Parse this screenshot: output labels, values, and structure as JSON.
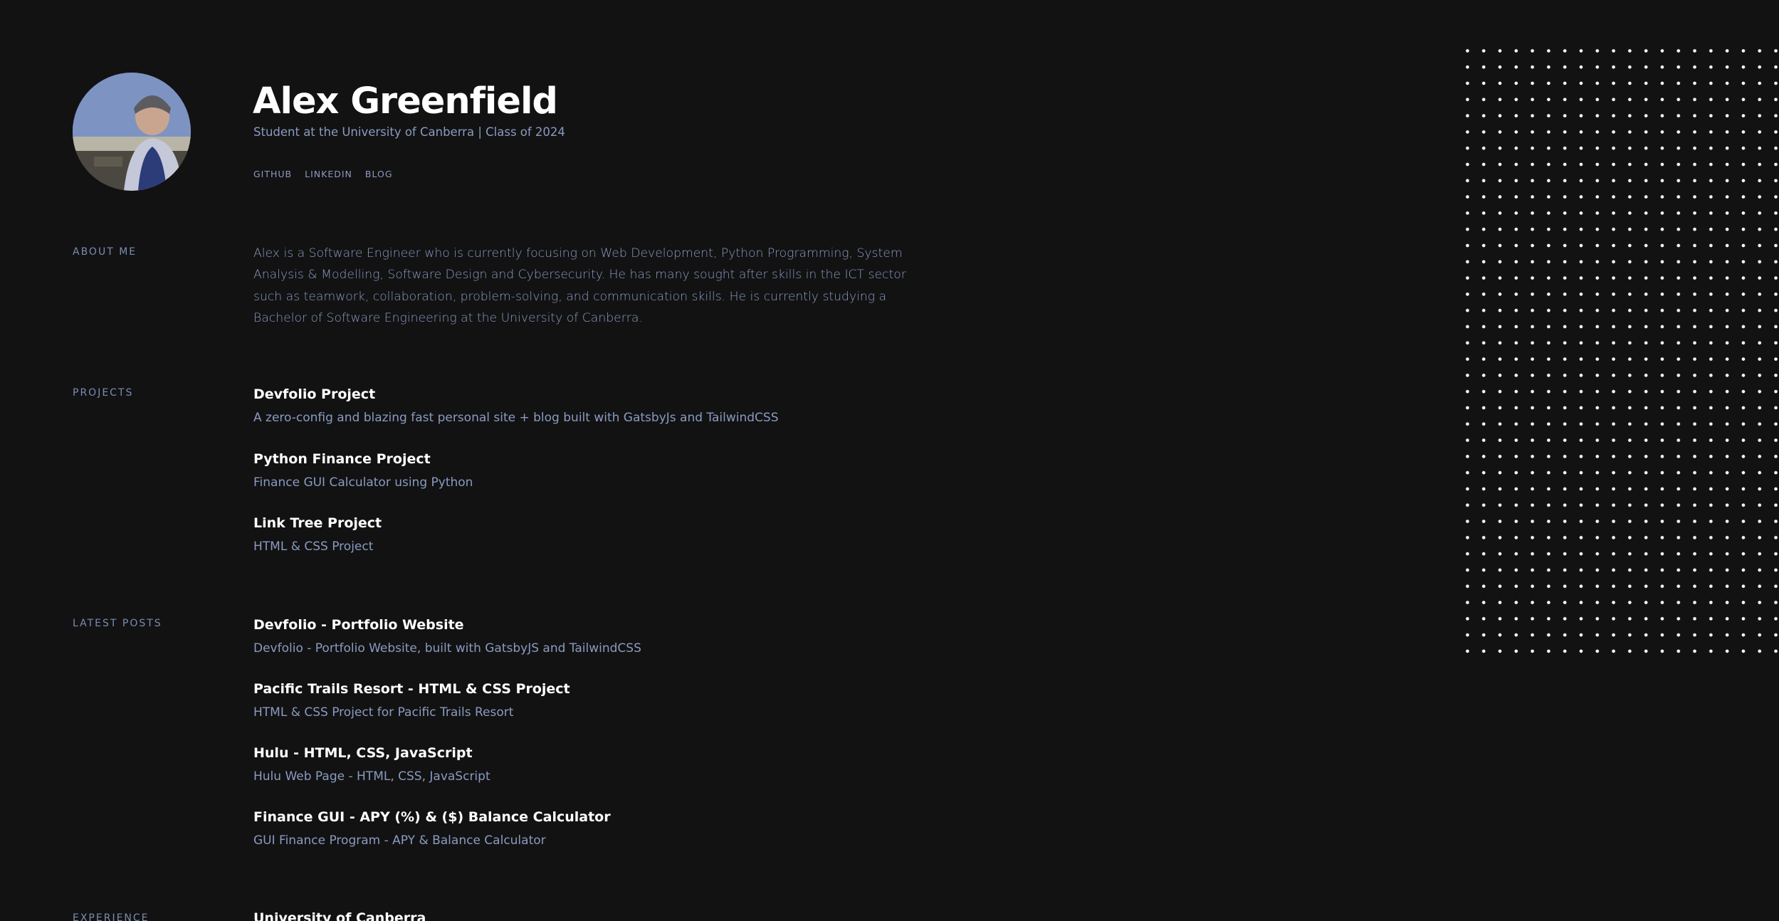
{
  "profile": {
    "name": "Alex Greenfield",
    "subtitle": "Student at the University of Canberra | Class of 2024",
    "links": [
      "GITHUB",
      "LINKEDIN",
      "BLOG"
    ]
  },
  "about": {
    "label": "ABOUT ME",
    "text": "Alex is a Software Engineer who is currently focusing on Web Development, Python Programming, System Analysis & Modelling, Software Design and Cybersecurity. He has many sought after skills in the ICT sector such as teamwork, collaboration, problem-solving, and communication skills. He is currently studying a Bachelor of Software Engineering at the University of Canberra."
  },
  "projects": {
    "label": "PROJECTS",
    "items": [
      {
        "title": "Devfolio Project",
        "description": "A zero-config and blazing fast personal site + blog built with GatsbyJs and TailwindCSS"
      },
      {
        "title": "Python Finance Project",
        "description": "Finance GUI Calculator using Python"
      },
      {
        "title": "Link Tree Project",
        "description": "HTML & CSS Project"
      }
    ]
  },
  "posts": {
    "label": "LATEST POSTS",
    "items": [
      {
        "title": "Devfolio - Portfolio Website",
        "description": "Devfolio - Portfolio Website, built with GatsbyJS and TailwindCSS"
      },
      {
        "title": "Pacific Trails Resort - HTML & CSS Project",
        "description": "HTML & CSS Project for Pacific Trails Resort"
      },
      {
        "title": "Hulu - HTML, CSS, JavaScript",
        "description": "Hulu Web Page - HTML, CSS, JavaScript"
      },
      {
        "title": "Finance GUI - APY (%) & ($) Balance Calculator",
        "description": "GUI Finance Program - APY & Balance Calculator"
      }
    ]
  },
  "experience": {
    "label": "EXPERIENCE",
    "items": [
      {
        "title": "University of Canberra"
      }
    ]
  },
  "colors": {
    "background": "#121213",
    "title": "#ffffff",
    "muted": "#8a9bbf"
  }
}
